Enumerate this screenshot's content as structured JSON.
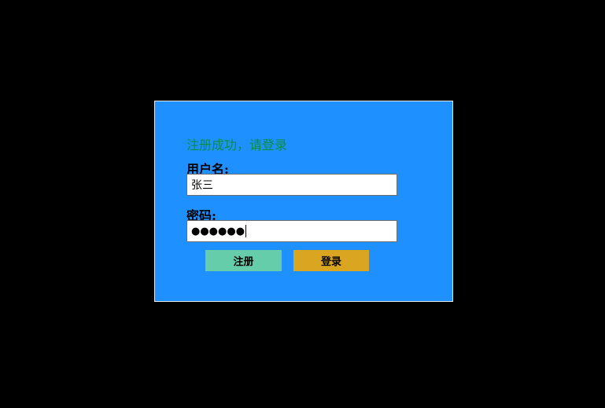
{
  "form": {
    "message": "注册成功，请登录",
    "username_label": "用户名:",
    "username_value": "张三",
    "password_label": "密码:",
    "password_masked": "●●●●●●",
    "register_label": "注册",
    "login_label": "登录"
  },
  "colors": {
    "background": "#000000",
    "panel": "#1e90ff",
    "message": "#0a8f3c",
    "register_button": "#66cdaa",
    "login_button": "#daa520"
  }
}
